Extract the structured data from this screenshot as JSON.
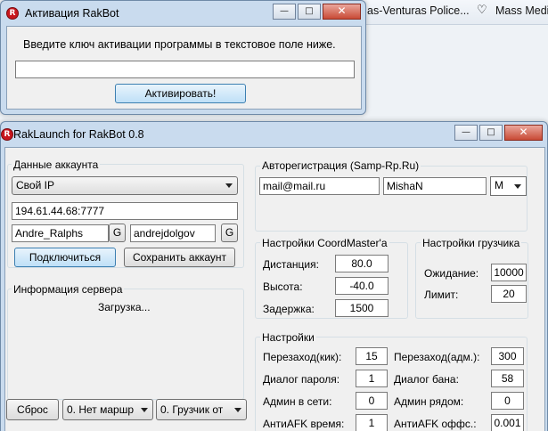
{
  "background": {
    "tab_right": "as-Venturas Police...",
    "tab_far": "Mass Medi"
  },
  "activation_window": {
    "title": "Активация RakBot",
    "instruction": "Введите ключ активации программы в текстовое поле ниже.",
    "key_value": "",
    "activate_label": "Активировать!",
    "min_glyph": "—",
    "max_glyph": "□",
    "close_glyph": "✕"
  },
  "main_window": {
    "title": "RakLaunch for RakBot 0.8",
    "min_glyph": "—",
    "max_glyph": "□",
    "close_glyph": "✕",
    "account": {
      "title": "Данные аккаунта",
      "ip_mode": "Свой IP",
      "server_address": "194.61.44.68:7777",
      "nickname": "Andre_Ralphs",
      "password": "andrejdolgov",
      "gen_label": "G",
      "connect_label": "Подключиться",
      "save_label": "Сохранить аккаунт"
    },
    "server_info": {
      "title": "Информация сервера",
      "status": "Загрузка..."
    },
    "bottom": {
      "reset_label": "Сброс",
      "route_value": "0. Нет маршр",
      "loader_value": "0. Грузчик от"
    },
    "autoreg": {
      "title": "Авторегистрация (Samp-Rp.Ru)",
      "email": "mail@mail.ru",
      "name": "MishaN",
      "gender": "M"
    },
    "coordmaster": {
      "title": "Настройки CoordMaster'a",
      "distance_label": "Дистанция:",
      "distance_value": "80.0",
      "height_label": "Высота:",
      "height_value": "-40.0",
      "delay_label": "Задержка:",
      "delay_value": "1500"
    },
    "loader": {
      "title": "Настройки грузчика",
      "wait_label": "Ожидание:",
      "wait_value": "10000",
      "limit_label": "Лимит:",
      "limit_value": "20"
    },
    "settings": {
      "title": "Настройки",
      "rejoin_kick_label": "Перезаход(кик):",
      "rejoin_kick_value": "15",
      "rejoin_admin_label": "Перезаход(адм.):",
      "rejoin_admin_value": "300",
      "password_dialog_label": "Диалог пароля:",
      "password_dialog_value": "1",
      "ban_dialog_label": "Диалог бана:",
      "ban_dialog_value": "58",
      "admin_online_label": "Админ в сети:",
      "admin_online_value": "0",
      "admin_near_label": "Админ рядом:",
      "admin_near_value": "0",
      "antiafk_time_label": "АнтиAFK время:",
      "antiafk_time_value": "1",
      "antiafk_offset_label": "АнтиAFK оффс.:",
      "antiafk_offset_value": "0.001"
    }
  }
}
